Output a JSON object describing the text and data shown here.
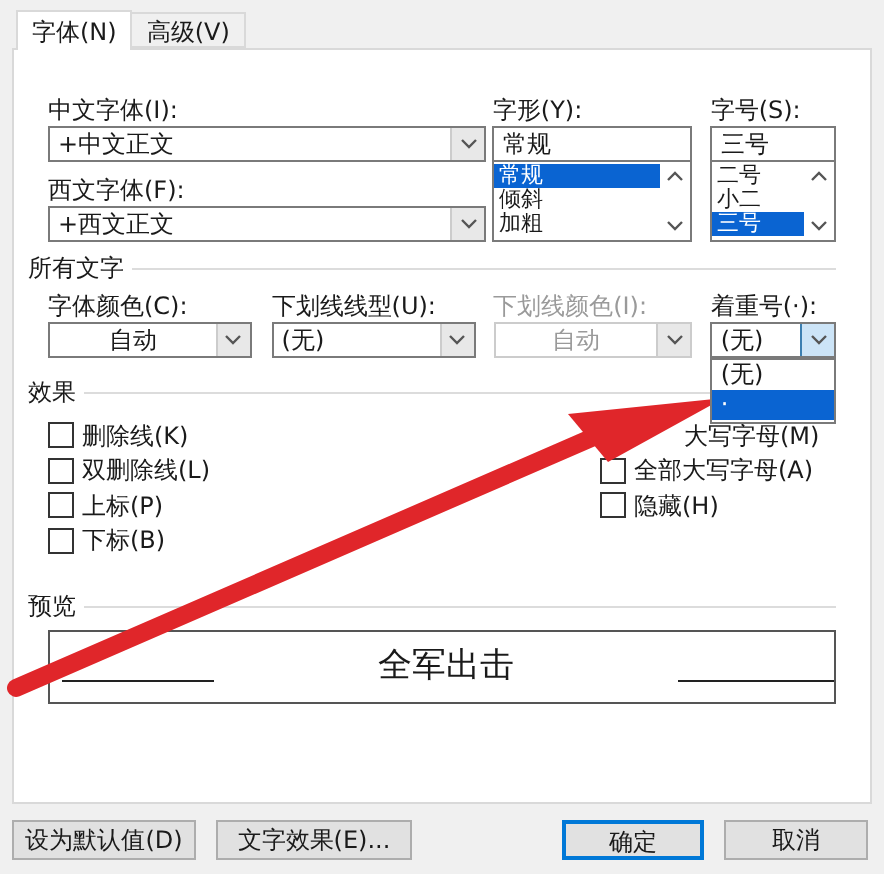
{
  "tabs": [
    {
      "label": "字体(N)",
      "selected": true
    },
    {
      "label": "高级(V)",
      "selected": false
    }
  ],
  "font_fields": [
    {
      "label": "中文字体(I):",
      "value": "+中文正文"
    },
    {
      "label": "西文字体(F):",
      "value": "+西文正文"
    }
  ],
  "style": {
    "label": "字形(Y):",
    "value": "常规",
    "options": [
      {
        "label": "常规",
        "selected": true
      },
      {
        "label": "倾斜",
        "selected": false
      },
      {
        "label": "加粗",
        "selected": false
      }
    ]
  },
  "size": {
    "label": "字号(S):",
    "value": "三号",
    "options": [
      {
        "label": "二号",
        "selected": false
      },
      {
        "label": "小二",
        "selected": false
      },
      {
        "label": "三号",
        "selected": true
      }
    ]
  },
  "all_text": {
    "heading": "所有文字",
    "fields": [
      {
        "label": "字体颜色(C):",
        "value": "自动",
        "disabled": false,
        "centered": true
      },
      {
        "label": "下划线线型(U):",
        "value": "(无)",
        "disabled": false,
        "centered": false
      },
      {
        "label": "下划线颜色(I):",
        "value": "自动",
        "disabled": true,
        "centered": true
      },
      {
        "label": "着重号(·):",
        "value": "(无)",
        "disabled": false,
        "centered": false,
        "open": true
      }
    ]
  },
  "emphasis_options": [
    {
      "label": "(无)",
      "selected": false
    },
    {
      "label": "·",
      "selected": true
    }
  ],
  "effects": {
    "heading": "效果",
    "left": [
      {
        "label": "删除线(K)",
        "checked": false
      },
      {
        "label": "双删除线(L)",
        "checked": false
      },
      {
        "label": "上标(P)",
        "checked": false
      },
      {
        "label": "下标(B)",
        "checked": false
      }
    ],
    "right": [
      {
        "label": "大写字母(M)"
      },
      {
        "label": "全部大写字母(A)",
        "checked": false
      },
      {
        "label": "隐藏(H)",
        "checked": false
      }
    ]
  },
  "preview": {
    "heading": "预览",
    "text": "全军出击"
  },
  "buttons": [
    {
      "label": "设为默认值(D)",
      "default": false
    },
    {
      "label": "文字效果(E)...",
      "default": false
    },
    {
      "label": "确定",
      "default": true
    },
    {
      "label": "取消",
      "default": false
    }
  ]
}
